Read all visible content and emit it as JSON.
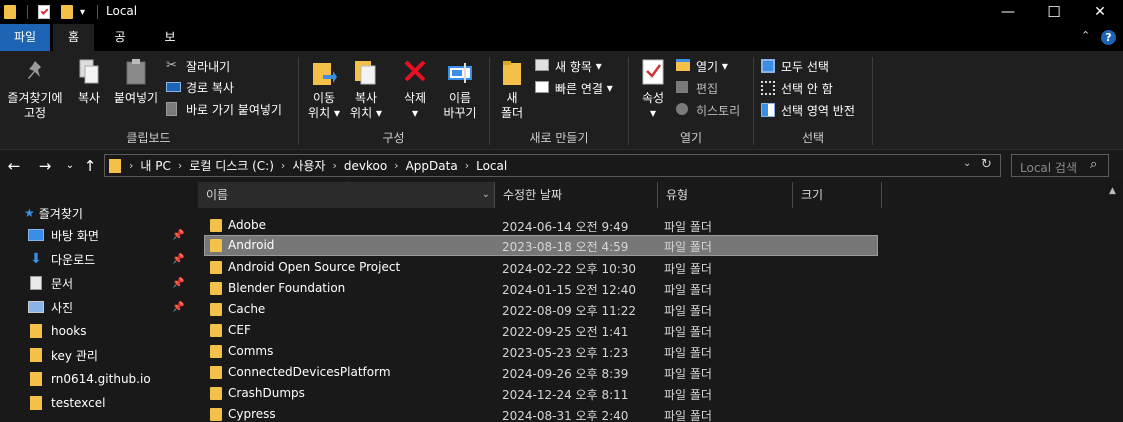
{
  "window": {
    "title": "Local",
    "minimize": "—",
    "maximize": "☐",
    "close": "✕"
  },
  "tabs": [
    {
      "label": "파일"
    },
    {
      "label": "홈"
    },
    {
      "label": "공유"
    },
    {
      "label": "보기"
    }
  ],
  "ribbon": {
    "clipboard": {
      "label": "클립보드",
      "pin": "즐겨찾기에\n고정",
      "pin_l1": "즐겨찾기에",
      "pin_l2": "고정",
      "copy": "복사",
      "paste": "붙여넣기",
      "cut": "잘라내기",
      "copy_path": "경로 복사",
      "paste_shortcut": "바로 가기 붙여넣기"
    },
    "organize": {
      "label": "구성",
      "move_l1": "이동",
      "move_l2": "위치",
      "copyto_l1": "복사",
      "copyto_l2": "위치",
      "delete": "삭제",
      "rename_l1": "이름",
      "rename_l2": "바꾸기"
    },
    "new": {
      "label": "새로 만들기",
      "folder_l1": "새",
      "folder_l2": "폴더",
      "new_item": "새 항목",
      "easy_access": "빠른 연결"
    },
    "open": {
      "label": "열기",
      "properties": "속성",
      "open": "열기",
      "edit": "편집",
      "history": "히스토리"
    },
    "select": {
      "label": "선택",
      "select_all": "모두 선택",
      "select_none": "선택 안 함",
      "invert": "선택 영역 반전"
    }
  },
  "address": {
    "crumbs": [
      "내 PC",
      "로컬 디스크 (C:)",
      "사용자",
      "devkoo",
      "AppData",
      "Local"
    ],
    "search_placeholder": "Local 검색"
  },
  "sidebar": {
    "quick_access": "즐겨찾기",
    "items": [
      {
        "label": "바탕 화면",
        "pinned": true
      },
      {
        "label": "다운로드",
        "pinned": true
      },
      {
        "label": "문서",
        "pinned": true
      },
      {
        "label": "사진",
        "pinned": true
      },
      {
        "label": "hooks",
        "pinned": false
      },
      {
        "label": "key 관리",
        "pinned": false
      },
      {
        "label": "rn0614.github.io",
        "pinned": false
      },
      {
        "label": "testexcel",
        "pinned": false
      }
    ]
  },
  "columns": {
    "name": "이름",
    "date": "수정한 날짜",
    "type": "유형",
    "size": "크기"
  },
  "files": [
    {
      "name": "Adobe",
      "date": "2024-06-14 오전 9:49",
      "type": "파일 폴더"
    },
    {
      "name": "Android",
      "date": "2023-08-18 오전 4:59",
      "type": "파일 폴더",
      "selected": true
    },
    {
      "name": "Android Open Source Project",
      "date": "2024-02-22 오후 10:30",
      "type": "파일 폴더"
    },
    {
      "name": "Blender Foundation",
      "date": "2024-01-15 오전 12:40",
      "type": "파일 폴더"
    },
    {
      "name": "Cache",
      "date": "2022-08-09 오후 11:22",
      "type": "파일 폴더"
    },
    {
      "name": "CEF",
      "date": "2022-09-25 오전 1:41",
      "type": "파일 폴더"
    },
    {
      "name": "Comms",
      "date": "2023-05-23 오후 1:23",
      "type": "파일 폴더"
    },
    {
      "name": "ConnectedDevicesPlatform",
      "date": "2024-09-26 오후 8:39",
      "type": "파일 폴더"
    },
    {
      "name": "CrashDumps",
      "date": "2024-12-24 오후 8:11",
      "type": "파일 폴더"
    },
    {
      "name": "Cypress",
      "date": "2024-08-31 오후 2:40",
      "type": "파일 폴더"
    }
  ]
}
